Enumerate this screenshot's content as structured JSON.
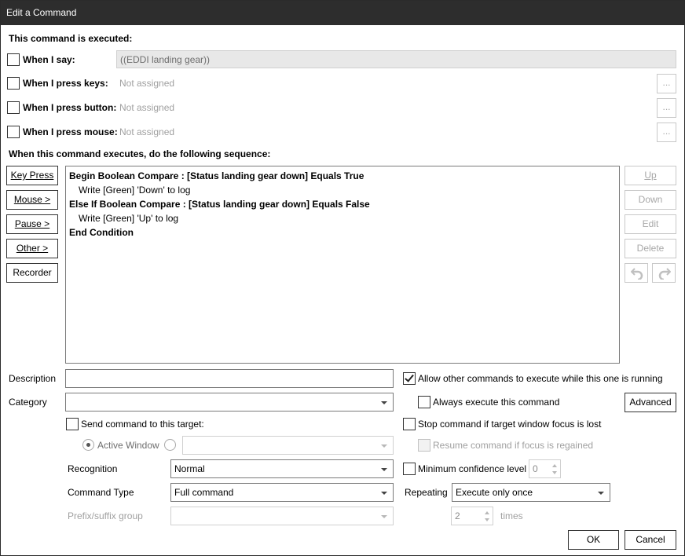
{
  "window": {
    "title": "Edit a Command"
  },
  "triggers": {
    "header": "This command is executed:",
    "say": {
      "label": "When I say:",
      "value": "((EDDI landing gear))"
    },
    "keys": {
      "label": "When I press keys:",
      "value": "Not assigned",
      "browse": "..."
    },
    "button": {
      "label": "When I press button:",
      "value": "Not assigned",
      "browse": "..."
    },
    "mouse": {
      "label": "When I press mouse:",
      "value": "Not assigned",
      "browse": "..."
    }
  },
  "sequence": {
    "header": "When this command executes, do the following sequence:",
    "lines": [
      "Begin Boolean Compare : [Status landing gear down] Equals True",
      "Write [Green] 'Down' to log",
      "Else If Boolean Compare : [Status landing gear down] Equals False",
      "Write [Green] 'Up' to log",
      "End Condition"
    ]
  },
  "left_buttons": {
    "key_press": "Key Press",
    "mouse": "Mouse >",
    "pause": "Pause >",
    "other": "Other >",
    "recorder": "Recorder"
  },
  "right_buttons": {
    "up": "Up",
    "down": "Down",
    "edit": "Edit",
    "delete": "Delete"
  },
  "form": {
    "description": {
      "label": "Description",
      "value": ""
    },
    "category": {
      "label": "Category",
      "value": ""
    },
    "send_target": {
      "label": "Send command to this target:"
    },
    "active_window": {
      "label": "Active Window",
      "value": ""
    },
    "recognition": {
      "label": "Recognition",
      "value": "Normal"
    },
    "command_type": {
      "label": "Command Type",
      "value": "Full command"
    },
    "prefix_suffix": {
      "label": "Prefix/suffix group",
      "value": ""
    }
  },
  "options": {
    "allow_other": "Allow other commands to execute while this one is running",
    "always_execute": "Always execute this command",
    "advanced": "Advanced",
    "stop_focus": "Stop command if target window focus is lost",
    "resume_focus": "Resume command if focus is regained",
    "min_confidence": {
      "label": "Minimum confidence level",
      "value": "0"
    },
    "repeating": {
      "label": "Repeating",
      "value": "Execute only once"
    },
    "times": {
      "value": "2",
      "label": "times"
    }
  },
  "footer": {
    "ok": "OK",
    "cancel": "Cancel"
  }
}
